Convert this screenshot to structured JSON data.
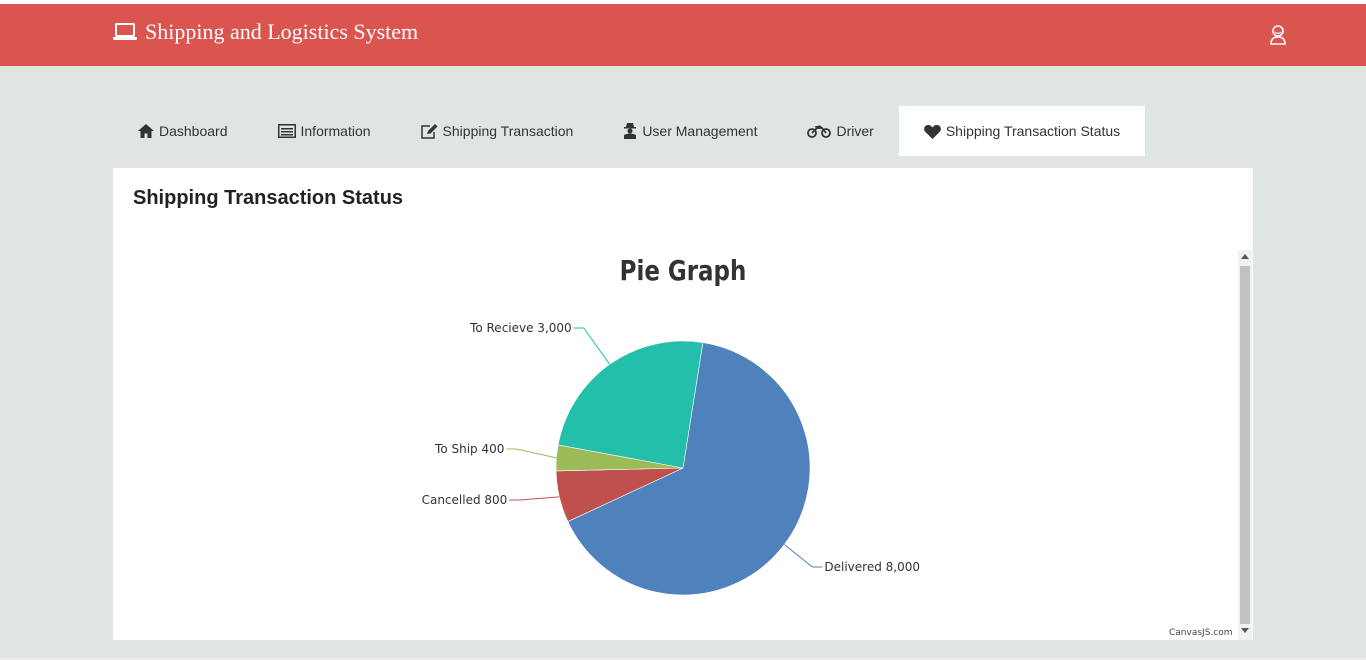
{
  "header": {
    "title": "Shipping and Logistics System",
    "brand_icon": "laptop-icon",
    "user_icon": "user-icon"
  },
  "tabs": [
    {
      "label": "Dashboard",
      "icon": "home-icon",
      "active": false
    },
    {
      "label": "Information",
      "icon": "list-icon",
      "active": false
    },
    {
      "label": "Shipping Transaction",
      "icon": "edit-icon",
      "active": false
    },
    {
      "label": "User Management",
      "icon": "user-secret-icon",
      "active": false
    },
    {
      "label": "Driver",
      "icon": "motorcycle-icon",
      "active": false
    },
    {
      "label": "Shipping Transaction Status",
      "icon": "heart-icon",
      "active": true
    }
  ],
  "panel": {
    "title": "Shipping Transaction Status"
  },
  "chart_data": {
    "type": "pie",
    "title": "Pie Graph",
    "series": [
      {
        "label": "Delivered",
        "value": 8000,
        "display": "Delivered 8,000",
        "color": "#4f81bc"
      },
      {
        "label": "Cancelled",
        "value": 800,
        "display": "Cancelled 800",
        "color": "#c0504e"
      },
      {
        "label": "To Ship",
        "value": 400,
        "display": "To Ship 400",
        "color": "#9bbb58"
      },
      {
        "label": "To Recieve",
        "value": 3000,
        "display": "To Recieve 3,000",
        "color": "#23bfaa"
      }
    ],
    "credit": "CanvasJS.com"
  },
  "colors": {
    "navbar": "#db5550",
    "background": "#dfe5e1",
    "panel": "#ffffff"
  }
}
